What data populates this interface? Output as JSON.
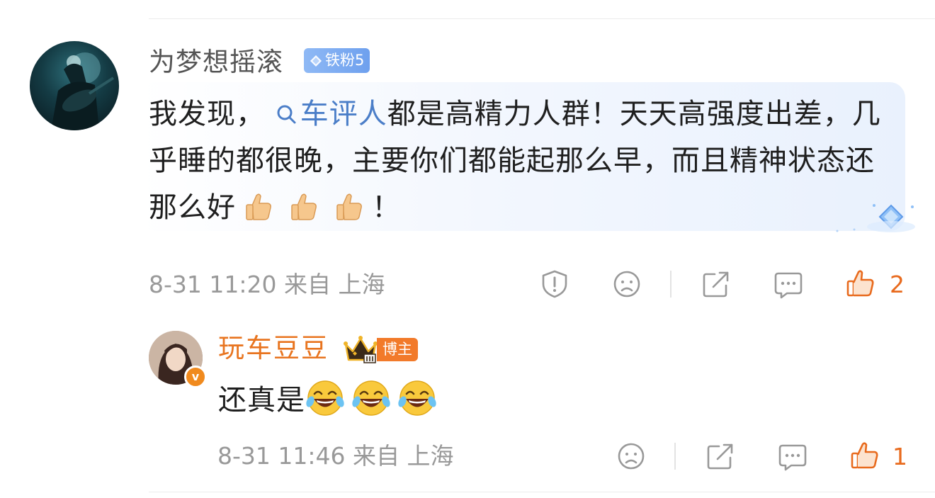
{
  "main_comment": {
    "username": "为梦想摇滚",
    "fan_badge": "铁粉5",
    "text_before_topic": "我发现，",
    "topic": "车评人",
    "text_after_topic": "都是高精力人群！天天高强度出差，几乎睡的都很晚，主要你们都能起那么早，而且精神状态还那么好",
    "text_end": "！",
    "emojis": [
      "thumbs-up",
      "thumbs-up",
      "thumbs-up"
    ],
    "meta": "8-31 11:20 来自 上海",
    "like_count": "2",
    "colors": {
      "username": "#555555",
      "topic_link": "#4b7ec8",
      "fan_badge_bg": "#7aa9f0",
      "like_accent": "#e86a1d"
    }
  },
  "reply": {
    "username": "玩车豆豆",
    "role_badge": "博主",
    "verified_mark": "v",
    "text": "还真是",
    "emojis": [
      "laughing-tears",
      "laughing-tears",
      "laughing-tears"
    ],
    "meta": "8-31 11:46 来自 上海",
    "like_count": "1",
    "colors": {
      "username": "#e8741f",
      "role_badge_bg": "#f27a2a"
    }
  },
  "icons": {
    "main_actions": [
      "report-icon",
      "dislike-face-icon",
      "share-icon",
      "comment-icon",
      "like-icon"
    ],
    "reply_actions": [
      "dislike-face-icon",
      "share-icon",
      "comment-icon",
      "like-icon"
    ]
  }
}
